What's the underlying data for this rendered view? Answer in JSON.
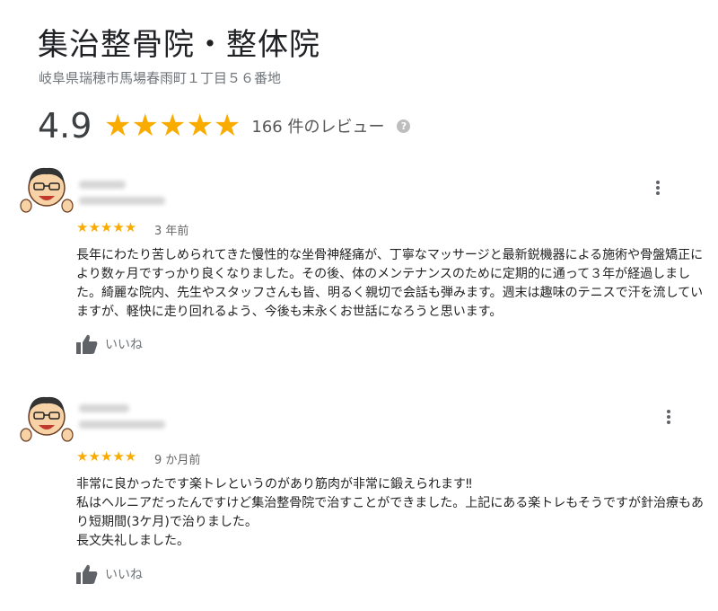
{
  "place": {
    "name": "集治整骨院・整体院",
    "address": "岐阜県瑞穂市馬場春雨町１丁目５６番地",
    "rating": "4.9",
    "stars": "★★★★★",
    "review_count": "166 件のレビュー",
    "help_icon": "?"
  },
  "colors": {
    "star": "#f9ab00",
    "muted": "#70757a"
  },
  "reviews": [
    {
      "stars": "★★★★★",
      "time": "3 年前",
      "text": "長年にわたり苦しめられてきた慢性的な坐骨神経痛が、丁寧なマッサージと最新鋭機器による施術や骨盤矯正により数ヶ月ですっかり良くなりました。その後、体のメンテナンスのために定期的に通って３年が経過しました。綺麗な院内、先生やスタッフさんも皆、明るく親切で会話も弾みます。週末は趣味のテニスで汗を流していますが、軽快に走り回れるよう、今後も末永くお世話になろうと思います。",
      "like_label": "いいね"
    },
    {
      "stars": "★★★★★",
      "time": "9 か月前",
      "text": "非常に良かったです楽トレというのがあり筋肉が非常に鍛えられます‼\n私はヘルニアだったんですけど集治整骨院で治すことができました。上記にある楽トレもそうですが針治療もあり短期間(3ケ月)で治りました。\n長文失礼しました。",
      "like_label": "いいね"
    }
  ]
}
